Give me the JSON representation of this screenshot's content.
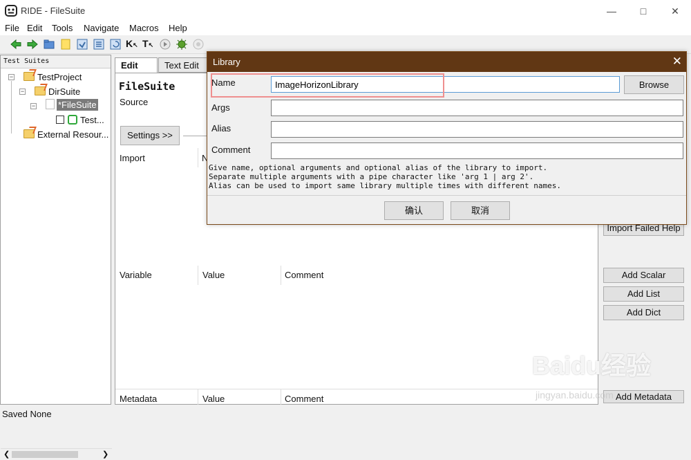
{
  "window": {
    "title": "RIDE - FileSuite"
  },
  "menu": [
    "File",
    "Edit",
    "Tools",
    "Navigate",
    "Macros",
    "Help"
  ],
  "tree": {
    "header": "Test Suites",
    "nodes": [
      "TestProject",
      "DirSuite",
      "*FileSuite",
      "Test...",
      "External Resour..."
    ]
  },
  "editor": {
    "tabs": [
      "Edit",
      "Text Edit"
    ],
    "suite_name": "FileSuite",
    "source_label": "Source",
    "settings_button": "Settings >>",
    "import_headers": [
      "Import",
      "N"
    ],
    "variable_headers": [
      "Variable",
      "Value",
      "Comment"
    ],
    "metadata_headers": [
      "Metadata",
      "Value",
      "Comment"
    ]
  },
  "side_buttons": {
    "import_failed_help": "Import Failed Help",
    "add_scalar": "Add Scalar",
    "add_list": "Add List",
    "add_dict": "Add Dict",
    "add_metadata": "Add Metadata"
  },
  "status": {
    "text": "Saved None"
  },
  "dialog": {
    "title": "Library",
    "name_label": "Name",
    "name_value": "ImageHorizonLibrary",
    "browse_button": "Browse",
    "args_label": "Args",
    "alias_label": "Alias",
    "comment_label": "Comment",
    "help_lines": [
      "Give name, optional arguments and optional alias of the library to import.",
      "Separate multiple arguments with a pipe character like 'arg 1 | arg 2'.",
      "Alias can be used to import same library multiple times with different names."
    ],
    "ok_button": "确认",
    "cancel_button": "取消"
  },
  "watermark": {
    "main": "Baidu经验",
    "sub": "jingyan.baidu.com"
  },
  "colors": {
    "dialog_title_bg": "#613714",
    "highlight": "#ef8f8f",
    "name_input_border": "#5a9bd5"
  }
}
